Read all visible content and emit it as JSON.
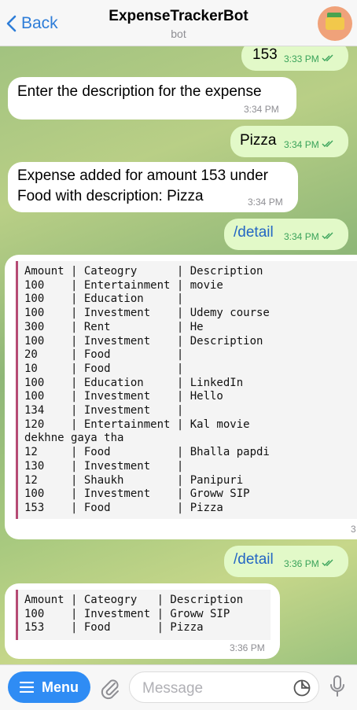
{
  "header": {
    "back_label": "Back",
    "title": "ExpenseTrackerBot",
    "subtitle": "bot"
  },
  "messages": [
    {
      "dir": "out",
      "text": "153",
      "time": "3:33 PM"
    },
    {
      "dir": "in",
      "text": "Enter the description for the expense",
      "time": "3:34 PM"
    },
    {
      "dir": "out",
      "text": "Pizza",
      "time": "3:34 PM"
    },
    {
      "dir": "in",
      "line1": "Expense added for amount 153 under",
      "line2": "Food with description: Pizza",
      "time": "3:34 PM"
    },
    {
      "dir": "out",
      "text": "/detail",
      "time": "3:34 PM"
    },
    {
      "dir": "in",
      "code": "Amount | Cateogry      | Description\n100    | Entertainment | movie\n100    | Education     |\n100    | Investment    | Udemy course\n300    | Rent          | He\n100    | Investment    | Description\n20     | Food          |\n10     | Food          |\n100    | Education     | LinkedIn\n100    | Investment    | Hello\n134    | Investment    |\n120    | Entertainment | Kal movie\ndekhne gaya tha\n12     | Food          | Bhalla papdi\n130    | Investment    |\n12     | Shaukh        | Panipuri\n100    | Investment    | Groww SIP\n153    | Food          | Pizza",
      "time": "3"
    },
    {
      "dir": "out",
      "text": "/detail",
      "time": "3:36 PM"
    },
    {
      "dir": "in",
      "code": "Amount | Cateogry   | Description\n100    | Investment | Groww SIP\n153    | Food       | Pizza",
      "time": "3:36 PM"
    }
  ],
  "composer": {
    "menu_label": "Menu",
    "placeholder": "Message"
  },
  "colors": {
    "accent": "#2f8cf4",
    "outgoing_bubble": "#e2f9c8",
    "incoming_bubble": "#ffffff",
    "code_border": "#b54a74"
  }
}
